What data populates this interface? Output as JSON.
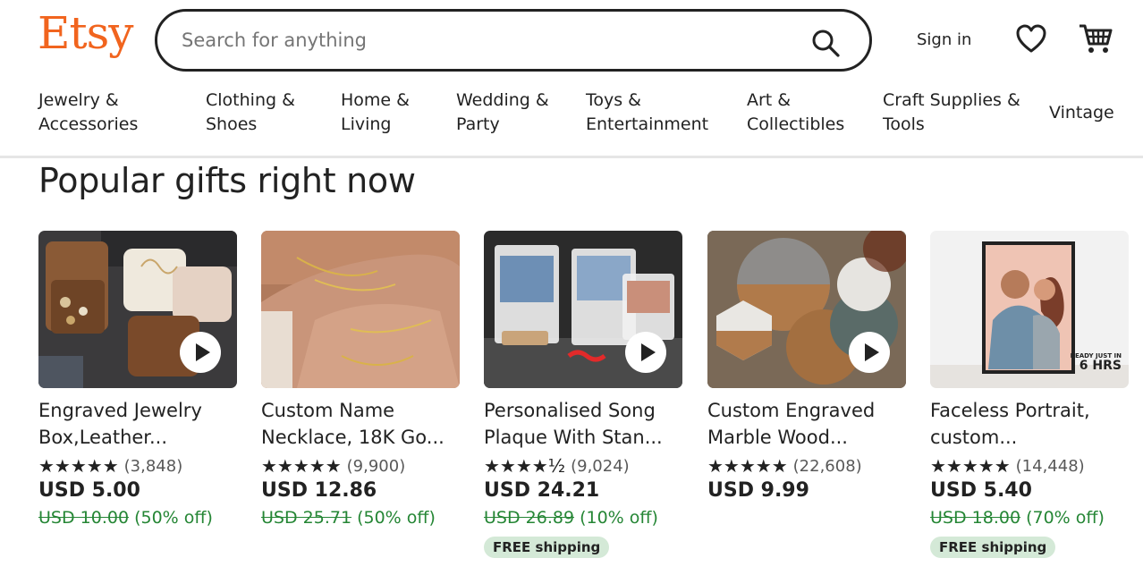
{
  "brand": {
    "logo": "Etsy",
    "accent": "#F1641E"
  },
  "search": {
    "placeholder": "Search for anything"
  },
  "header": {
    "sign_in": "Sign in"
  },
  "nav": [
    {
      "line1": "Jewelry &",
      "line2": "Accessories"
    },
    {
      "line1": "Clothing &",
      "line2": "Shoes"
    },
    {
      "line1": "Home &",
      "line2": "Living"
    },
    {
      "line1": "Wedding &",
      "line2": "Party"
    },
    {
      "line1": "Toys &",
      "line2": "Entertainment"
    },
    {
      "line1": "Art &",
      "line2": "Collectibles"
    },
    {
      "line1": "Craft Supplies &",
      "line2": "Tools"
    },
    {
      "line1": "Vintage",
      "line2": ""
    }
  ],
  "section": {
    "title": "Popular gifts right now"
  },
  "products": [
    {
      "title": "Engraved Jewelry Box,Leather...",
      "stars": "★★★★★",
      "rating": 5,
      "reviews": "(3,848)",
      "price": "USD 5.00",
      "original": "USD 10.00",
      "discount": "(50% off)",
      "shipping": ""
    },
    {
      "title": "Custom Name Necklace, 18K Go...",
      "stars": "★★★★★",
      "rating": 5,
      "reviews": "(9,900)",
      "price": "USD 12.86",
      "original": "USD 25.71",
      "discount": "(50% off)",
      "shipping": ""
    },
    {
      "title": "Personalised Song Plaque With Stan...",
      "stars": "★★★★½",
      "rating": 4.5,
      "reviews": "(9,024)",
      "price": "USD 24.21",
      "original": "USD 26.89",
      "discount": "(10% off)",
      "shipping": "FREE shipping"
    },
    {
      "title": "Custom Engraved Marble Wood...",
      "stars": "★★★★★",
      "rating": 5,
      "reviews": "(22,608)",
      "price": "USD 9.99",
      "original": "",
      "discount": "",
      "shipping": ""
    },
    {
      "title": "Faceless Portrait, custom...",
      "stars": "★★★★★",
      "rating": 5,
      "reviews": "(14,448)",
      "price": "USD 5.40",
      "original": "USD 18.00",
      "discount": "(70% off)",
      "shipping": "FREE shipping"
    }
  ],
  "thumb_text": {
    "portrait_small": "READY JUST IN",
    "portrait_big": "6 HRS"
  }
}
